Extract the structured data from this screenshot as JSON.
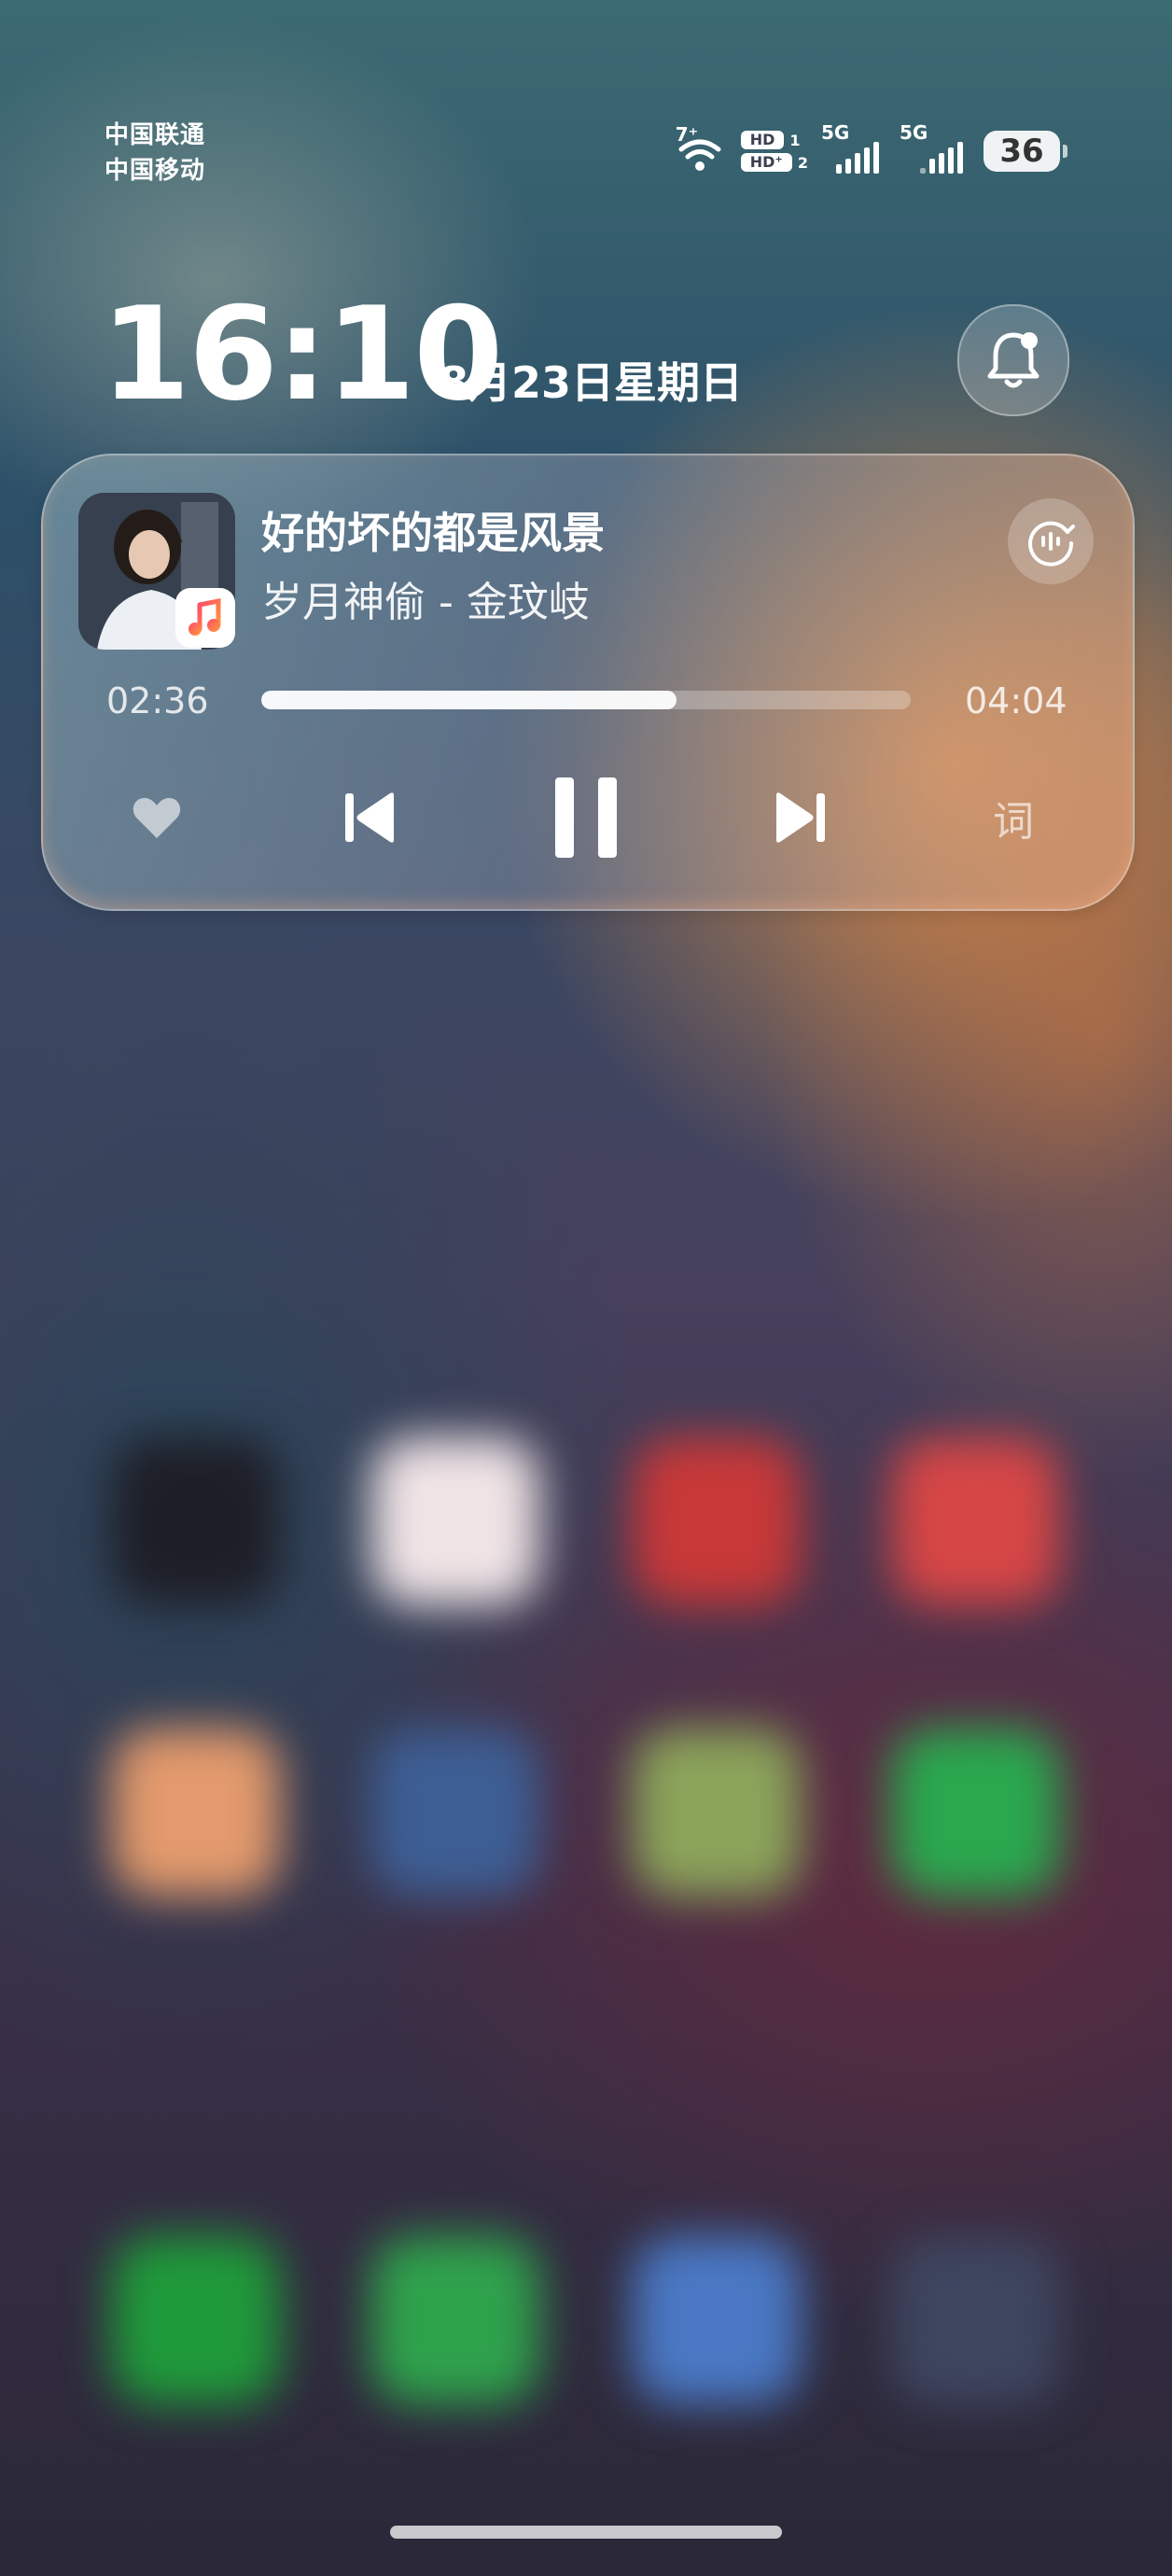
{
  "status_bar": {
    "carrier_1": "中国联通",
    "carrier_2": "中国移动",
    "wifi_label": "7⁺",
    "hd_1": "HD",
    "hd_1_num": "1",
    "hd_2": "HD⁺",
    "hd_2_num": "2",
    "net_1": "5G",
    "net_2": "5G",
    "battery": "36"
  },
  "lock": {
    "time": "16:10",
    "date": "8月23日星期日"
  },
  "player": {
    "title": "好的坏的都是风景",
    "artist": "岁月神偷 - 金玟岐",
    "elapsed": "02:36",
    "total": "04:04",
    "progress": 0.64,
    "lyrics_label": "词"
  }
}
